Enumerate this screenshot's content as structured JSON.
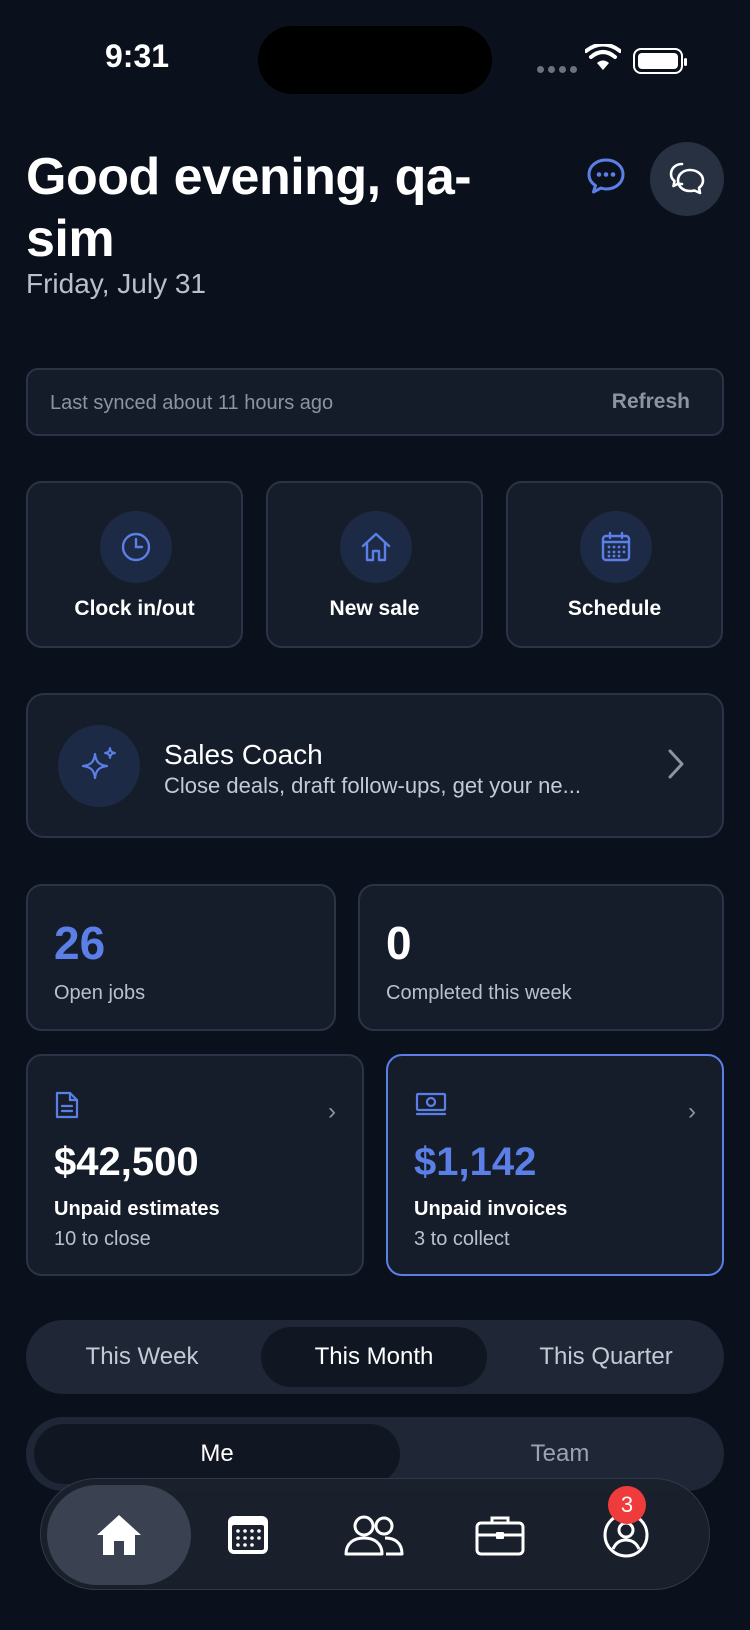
{
  "status_bar": {
    "time": "9:31"
  },
  "header": {
    "greeting": "Good evening, qa-sim",
    "date": "Friday, July 31"
  },
  "sync": {
    "text": "Last synced about 11 hours ago",
    "refresh_label": "Refresh"
  },
  "quick_actions": [
    {
      "label": "Clock in/out",
      "icon": "clock-icon"
    },
    {
      "label": "New sale",
      "icon": "house-icon"
    },
    {
      "label": "Schedule",
      "icon": "calendar-icon"
    }
  ],
  "sales_coach": {
    "title": "Sales Coach",
    "subtitle": "Close deals, draft follow-ups, get your ne...",
    "icon": "sparkles-icon"
  },
  "stats": {
    "open_jobs": {
      "value": "26",
      "label": "Open jobs"
    },
    "completed": {
      "value": "0",
      "label": "Completed this week"
    }
  },
  "money": {
    "estimates": {
      "value": "$42,500",
      "label": "Unpaid estimates",
      "sub": "10 to close",
      "icon": "document-icon"
    },
    "invoices": {
      "value": "$1,142",
      "label": "Unpaid invoices",
      "sub": "3 to collect",
      "icon": "cash-icon"
    }
  },
  "period": {
    "options": [
      "This Week",
      "This Month",
      "This Quarter"
    ],
    "selected": "This Month"
  },
  "scope": {
    "options": [
      "Me",
      "Team"
    ],
    "selected": "Me"
  },
  "tab_bar": {
    "items": [
      "home-icon",
      "calendar-icon",
      "users-icon",
      "briefcase-icon",
      "profile-icon"
    ],
    "active": "home-icon",
    "profile_badge": "3"
  },
  "colors": {
    "accent": "#5b7fe6",
    "background": "#0b111c",
    "card": "#161d2a",
    "badge": "#ef3b3b"
  }
}
